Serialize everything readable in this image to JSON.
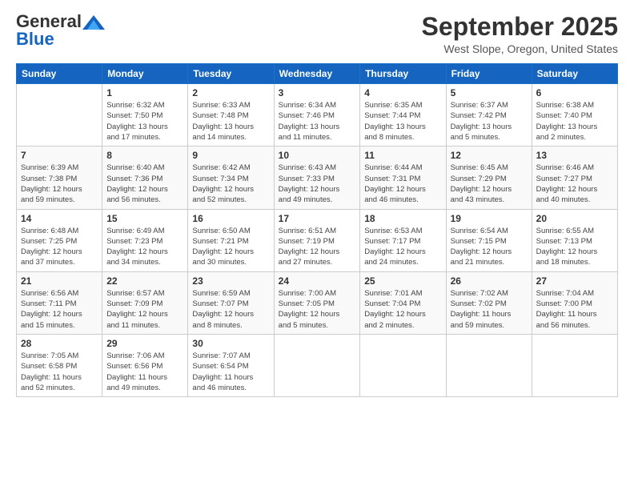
{
  "header": {
    "logo_general": "General",
    "logo_blue": "Blue",
    "month_title": "September 2025",
    "location": "West Slope, Oregon, United States"
  },
  "days_of_week": [
    "Sunday",
    "Monday",
    "Tuesday",
    "Wednesday",
    "Thursday",
    "Friday",
    "Saturday"
  ],
  "weeks": [
    [
      {
        "day": "",
        "info": ""
      },
      {
        "day": "1",
        "info": "Sunrise: 6:32 AM\nSunset: 7:50 PM\nDaylight: 13 hours\nand 17 minutes."
      },
      {
        "day": "2",
        "info": "Sunrise: 6:33 AM\nSunset: 7:48 PM\nDaylight: 13 hours\nand 14 minutes."
      },
      {
        "day": "3",
        "info": "Sunrise: 6:34 AM\nSunset: 7:46 PM\nDaylight: 13 hours\nand 11 minutes."
      },
      {
        "day": "4",
        "info": "Sunrise: 6:35 AM\nSunset: 7:44 PM\nDaylight: 13 hours\nand 8 minutes."
      },
      {
        "day": "5",
        "info": "Sunrise: 6:37 AM\nSunset: 7:42 PM\nDaylight: 13 hours\nand 5 minutes."
      },
      {
        "day": "6",
        "info": "Sunrise: 6:38 AM\nSunset: 7:40 PM\nDaylight: 13 hours\nand 2 minutes."
      }
    ],
    [
      {
        "day": "7",
        "info": "Sunrise: 6:39 AM\nSunset: 7:38 PM\nDaylight: 12 hours\nand 59 minutes."
      },
      {
        "day": "8",
        "info": "Sunrise: 6:40 AM\nSunset: 7:36 PM\nDaylight: 12 hours\nand 56 minutes."
      },
      {
        "day": "9",
        "info": "Sunrise: 6:42 AM\nSunset: 7:34 PM\nDaylight: 12 hours\nand 52 minutes."
      },
      {
        "day": "10",
        "info": "Sunrise: 6:43 AM\nSunset: 7:33 PM\nDaylight: 12 hours\nand 49 minutes."
      },
      {
        "day": "11",
        "info": "Sunrise: 6:44 AM\nSunset: 7:31 PM\nDaylight: 12 hours\nand 46 minutes."
      },
      {
        "day": "12",
        "info": "Sunrise: 6:45 AM\nSunset: 7:29 PM\nDaylight: 12 hours\nand 43 minutes."
      },
      {
        "day": "13",
        "info": "Sunrise: 6:46 AM\nSunset: 7:27 PM\nDaylight: 12 hours\nand 40 minutes."
      }
    ],
    [
      {
        "day": "14",
        "info": "Sunrise: 6:48 AM\nSunset: 7:25 PM\nDaylight: 12 hours\nand 37 minutes."
      },
      {
        "day": "15",
        "info": "Sunrise: 6:49 AM\nSunset: 7:23 PM\nDaylight: 12 hours\nand 34 minutes."
      },
      {
        "day": "16",
        "info": "Sunrise: 6:50 AM\nSunset: 7:21 PM\nDaylight: 12 hours\nand 30 minutes."
      },
      {
        "day": "17",
        "info": "Sunrise: 6:51 AM\nSunset: 7:19 PM\nDaylight: 12 hours\nand 27 minutes."
      },
      {
        "day": "18",
        "info": "Sunrise: 6:53 AM\nSunset: 7:17 PM\nDaylight: 12 hours\nand 24 minutes."
      },
      {
        "day": "19",
        "info": "Sunrise: 6:54 AM\nSunset: 7:15 PM\nDaylight: 12 hours\nand 21 minutes."
      },
      {
        "day": "20",
        "info": "Sunrise: 6:55 AM\nSunset: 7:13 PM\nDaylight: 12 hours\nand 18 minutes."
      }
    ],
    [
      {
        "day": "21",
        "info": "Sunrise: 6:56 AM\nSunset: 7:11 PM\nDaylight: 12 hours\nand 15 minutes."
      },
      {
        "day": "22",
        "info": "Sunrise: 6:57 AM\nSunset: 7:09 PM\nDaylight: 12 hours\nand 11 minutes."
      },
      {
        "day": "23",
        "info": "Sunrise: 6:59 AM\nSunset: 7:07 PM\nDaylight: 12 hours\nand 8 minutes."
      },
      {
        "day": "24",
        "info": "Sunrise: 7:00 AM\nSunset: 7:05 PM\nDaylight: 12 hours\nand 5 minutes."
      },
      {
        "day": "25",
        "info": "Sunrise: 7:01 AM\nSunset: 7:04 PM\nDaylight: 12 hours\nand 2 minutes."
      },
      {
        "day": "26",
        "info": "Sunrise: 7:02 AM\nSunset: 7:02 PM\nDaylight: 11 hours\nand 59 minutes."
      },
      {
        "day": "27",
        "info": "Sunrise: 7:04 AM\nSunset: 7:00 PM\nDaylight: 11 hours\nand 56 minutes."
      }
    ],
    [
      {
        "day": "28",
        "info": "Sunrise: 7:05 AM\nSunset: 6:58 PM\nDaylight: 11 hours\nand 52 minutes."
      },
      {
        "day": "29",
        "info": "Sunrise: 7:06 AM\nSunset: 6:56 PM\nDaylight: 11 hours\nand 49 minutes."
      },
      {
        "day": "30",
        "info": "Sunrise: 7:07 AM\nSunset: 6:54 PM\nDaylight: 11 hours\nand 46 minutes."
      },
      {
        "day": "",
        "info": ""
      },
      {
        "day": "",
        "info": ""
      },
      {
        "day": "",
        "info": ""
      },
      {
        "day": "",
        "info": ""
      }
    ]
  ]
}
